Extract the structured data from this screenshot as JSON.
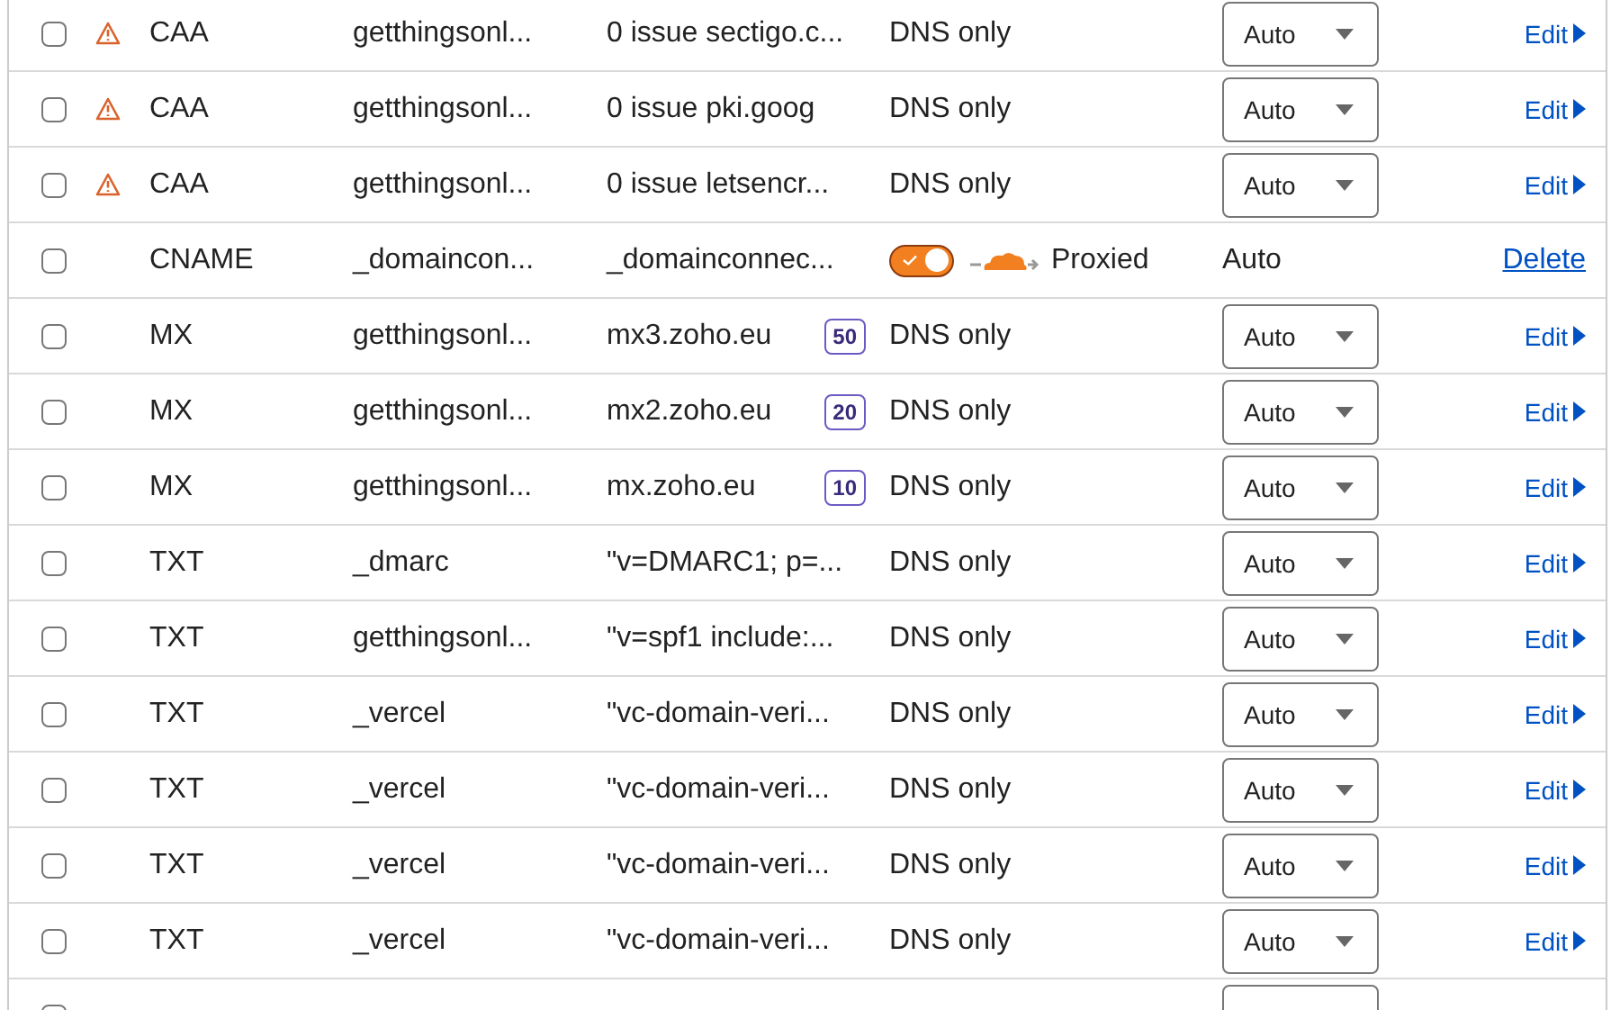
{
  "rows": [
    {
      "checked": false,
      "warning": true,
      "type": "CAA",
      "name": "getthingsonl...",
      "content": "0 issue sectigo.c...",
      "proxy": {
        "kind": "dns_only",
        "label": "DNS only"
      },
      "ttl": {
        "kind": "select",
        "value": "Auto"
      },
      "action": {
        "kind": "edit",
        "label": "Edit"
      }
    },
    {
      "checked": false,
      "warning": true,
      "type": "CAA",
      "name": "getthingsonl...",
      "content": "0 issue pki.goog",
      "proxy": {
        "kind": "dns_only",
        "label": "DNS only"
      },
      "ttl": {
        "kind": "select",
        "value": "Auto"
      },
      "action": {
        "kind": "edit",
        "label": "Edit"
      }
    },
    {
      "checked": false,
      "warning": true,
      "type": "CAA",
      "name": "getthingsonl...",
      "content": "0 issue letsencr...",
      "proxy": {
        "kind": "dns_only",
        "label": "DNS only"
      },
      "ttl": {
        "kind": "select",
        "value": "Auto"
      },
      "action": {
        "kind": "edit",
        "label": "Edit"
      }
    },
    {
      "checked": false,
      "warning": false,
      "type": "CNAME",
      "name": "_domaincon...",
      "content": "_domainconnec...",
      "proxy": {
        "kind": "proxied",
        "on": true,
        "label": "Proxied"
      },
      "ttl": {
        "kind": "text",
        "value": "Auto"
      },
      "action": {
        "kind": "delete",
        "label": "Delete"
      }
    },
    {
      "checked": false,
      "warning": false,
      "type": "MX",
      "name": "getthingsonl...",
      "content": "mx3.zoho.eu",
      "priority": "50",
      "proxy": {
        "kind": "dns_only",
        "label": "DNS only"
      },
      "ttl": {
        "kind": "select",
        "value": "Auto"
      },
      "action": {
        "kind": "edit",
        "label": "Edit"
      }
    },
    {
      "checked": false,
      "warning": false,
      "type": "MX",
      "name": "getthingsonl...",
      "content": "mx2.zoho.eu",
      "priority": "20",
      "proxy": {
        "kind": "dns_only",
        "label": "DNS only"
      },
      "ttl": {
        "kind": "select",
        "value": "Auto"
      },
      "action": {
        "kind": "edit",
        "label": "Edit"
      }
    },
    {
      "checked": false,
      "warning": false,
      "type": "MX",
      "name": "getthingsonl...",
      "content": "mx.zoho.eu",
      "priority": "10",
      "proxy": {
        "kind": "dns_only",
        "label": "DNS only"
      },
      "ttl": {
        "kind": "select",
        "value": "Auto"
      },
      "action": {
        "kind": "edit",
        "label": "Edit"
      }
    },
    {
      "checked": false,
      "warning": false,
      "type": "TXT",
      "name": "_dmarc",
      "content": "\"v=DMARC1; p=...",
      "proxy": {
        "kind": "dns_only",
        "label": "DNS only"
      },
      "ttl": {
        "kind": "select",
        "value": "Auto"
      },
      "action": {
        "kind": "edit",
        "label": "Edit"
      }
    },
    {
      "checked": false,
      "warning": false,
      "type": "TXT",
      "name": "getthingsonl...",
      "content": "\"v=spf1 include:...",
      "proxy": {
        "kind": "dns_only",
        "label": "DNS only"
      },
      "ttl": {
        "kind": "select",
        "value": "Auto"
      },
      "action": {
        "kind": "edit",
        "label": "Edit"
      }
    },
    {
      "checked": false,
      "warning": false,
      "type": "TXT",
      "name": "_vercel",
      "content": "\"vc-domain-veri...",
      "proxy": {
        "kind": "dns_only",
        "label": "DNS only"
      },
      "ttl": {
        "kind": "select",
        "value": "Auto"
      },
      "action": {
        "kind": "edit",
        "label": "Edit"
      }
    },
    {
      "checked": false,
      "warning": false,
      "type": "TXT",
      "name": "_vercel",
      "content": "\"vc-domain-veri...",
      "proxy": {
        "kind": "dns_only",
        "label": "DNS only"
      },
      "ttl": {
        "kind": "select",
        "value": "Auto"
      },
      "action": {
        "kind": "edit",
        "label": "Edit"
      }
    },
    {
      "checked": false,
      "warning": false,
      "type": "TXT",
      "name": "_vercel",
      "content": "\"vc-domain-veri...",
      "proxy": {
        "kind": "dns_only",
        "label": "DNS only"
      },
      "ttl": {
        "kind": "select",
        "value": "Auto"
      },
      "action": {
        "kind": "edit",
        "label": "Edit"
      }
    },
    {
      "checked": false,
      "warning": false,
      "type": "TXT",
      "name": "_vercel",
      "content": "\"vc-domain-veri...",
      "proxy": {
        "kind": "dns_only",
        "label": "DNS only"
      },
      "ttl": {
        "kind": "select",
        "value": "Auto"
      },
      "action": {
        "kind": "edit",
        "label": "Edit"
      }
    },
    {
      "checked": false,
      "ttl": {
        "kind": "select"
      }
    }
  ]
}
